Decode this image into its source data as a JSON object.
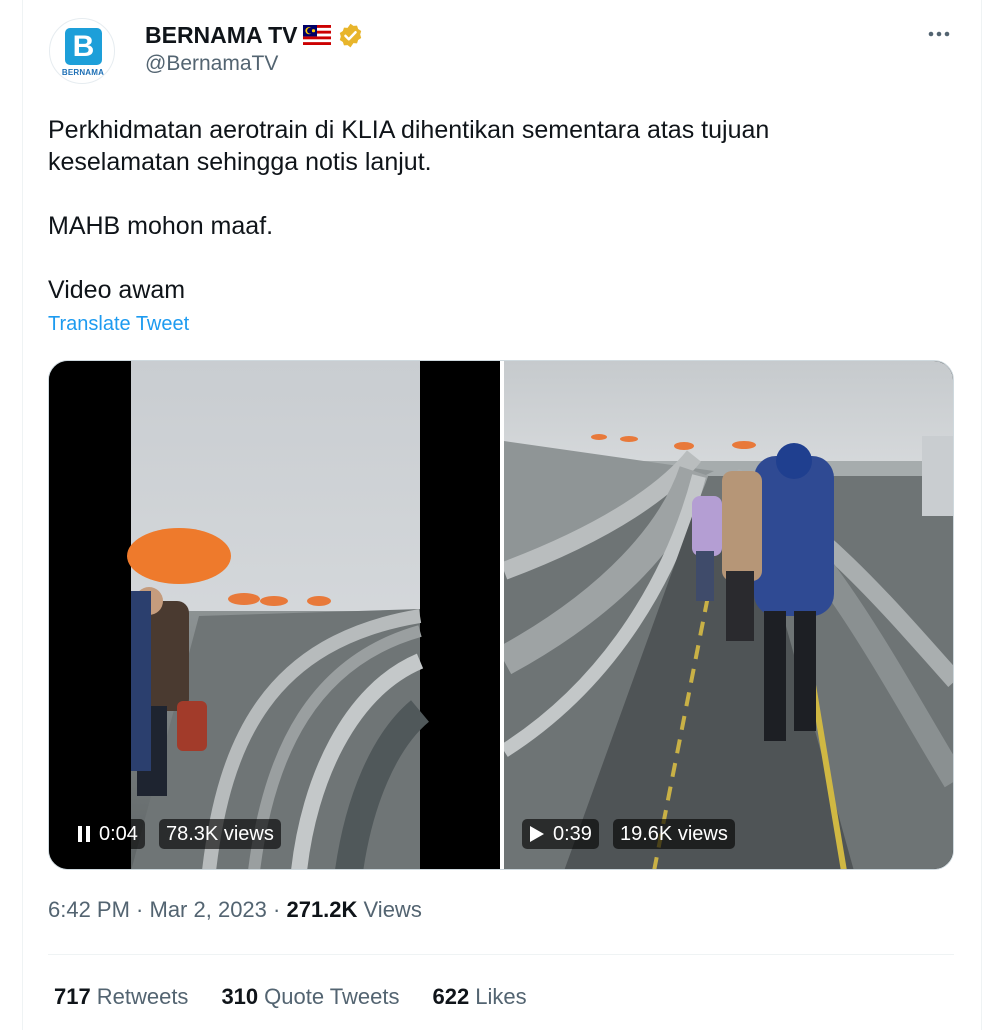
{
  "author": {
    "display_name": "BERNAMA TV",
    "handle": "@BernamaTV",
    "avatar_brand": "BERNAMA",
    "avatar_letter": "B",
    "flag_icon": "malaysia-flag-icon",
    "verified_icon": "gold-verified-badge-icon",
    "brand_color": "#1d9fd9"
  },
  "tweet": {
    "line1": "Perkhidmatan aerotrain di KLIA dihentikan sementara atas tujuan",
    "line2": "keselamatan sehingga notis lanjut.",
    "line3": "MAHB mohon maaf.",
    "line4": "Video awam",
    "translate_label": "Translate Tweet"
  },
  "media": {
    "videos": [
      {
        "state_icon": "pause-icon",
        "time": "0:04",
        "views": "78.3K views"
      },
      {
        "state_icon": "play-icon",
        "time": "0:39",
        "views": "19.6K views"
      }
    ]
  },
  "meta": {
    "time": "6:42 PM",
    "sep1": " · ",
    "date": "Mar 2, 2023",
    "sep2": " · ",
    "views_count": "271.2K",
    "views_label": " Views"
  },
  "stats": {
    "retweets_count": "717",
    "retweets_label": "Retweets",
    "quotes_count": "310",
    "quotes_label": "Quote Tweets",
    "likes_count": "622",
    "likes_label": "Likes"
  },
  "colors": {
    "link": "#1d9bf0",
    "secondary_text": "#536471",
    "primary_text": "#0f1419",
    "verified": "#e8b52b"
  }
}
